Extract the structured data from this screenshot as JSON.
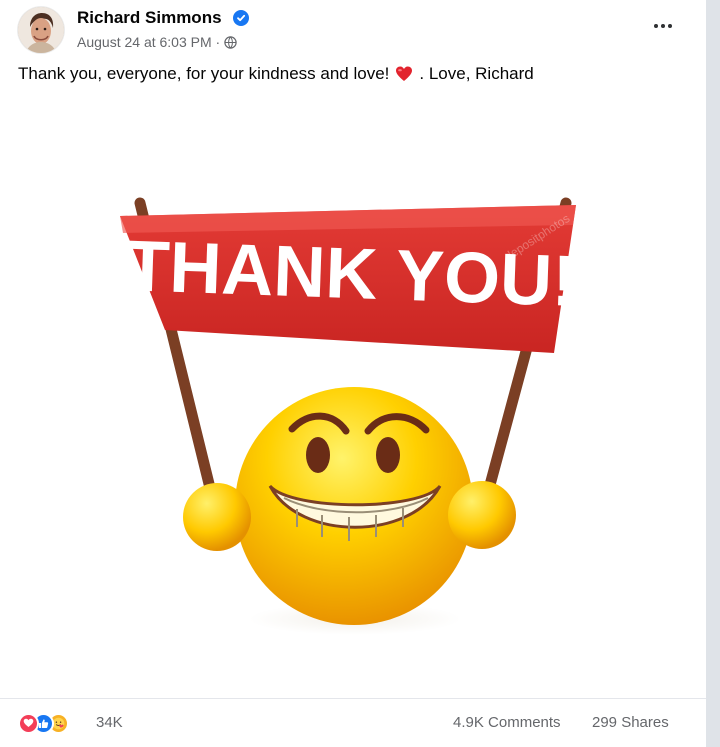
{
  "post": {
    "author": {
      "name": "Richard Simmons",
      "verified_icon": "verified-check-icon"
    },
    "timestamp": "August 24 at 6:03 PM ·",
    "privacy_icon": "globe-icon",
    "more_icon": "more-options-icon",
    "caption": {
      "before_emoji": "Thank you, everyone, for your kindness and love!",
      "emoji": "heart-emoji",
      "after_emoji": ". Love, Richard"
    },
    "image": {
      "banner_text": "THANK YOU!",
      "watermark": "depositphotos",
      "colors": {
        "banner": "#d62d2a",
        "smiley": "#f7c300",
        "pole": "#7b3f24"
      }
    },
    "footer": {
      "reactions": [
        "love-reaction-icon",
        "like-reaction-icon",
        "care-reaction-icon"
      ],
      "reaction_count": "34K",
      "comments": "4.9K Comments",
      "shares": "299 Shares"
    }
  }
}
